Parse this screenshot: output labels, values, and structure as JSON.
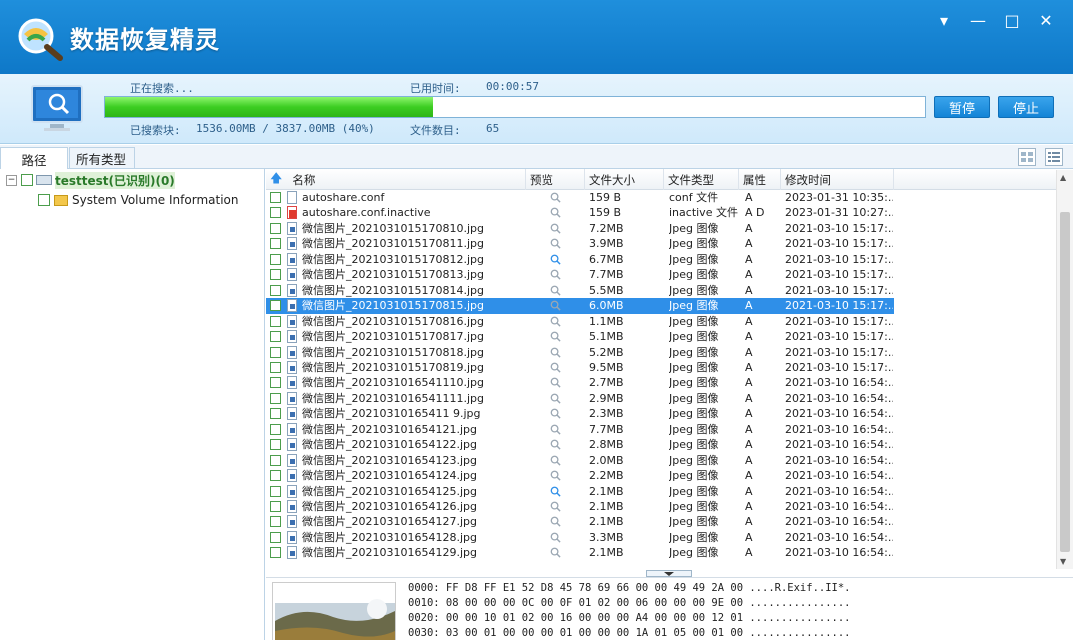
{
  "app": {
    "title": "数据恢复精灵"
  },
  "window_buttons": {
    "menu": "▾",
    "minimize": "—",
    "maximize": "□",
    "close": "✕"
  },
  "status": {
    "searching_label": "正在搜索...",
    "elapsed_label": "已用时间:",
    "elapsed_value": "00:00:57",
    "scanned_label": "已搜索块:",
    "scanned_value": "1536.00MB / 3837.00MB (40%)",
    "file_count_label": "文件数目:",
    "file_count_value": "65",
    "progress": 0.4,
    "pause_button": "暂停",
    "stop_button": "停止"
  },
  "tabs": [
    {
      "label": "路径"
    },
    {
      "label": "所有类型"
    }
  ],
  "tree": [
    {
      "label": "testtest(已识别)(0)"
    },
    {
      "label": "System Volume Information"
    }
  ],
  "columns": [
    "名称",
    "预览",
    "文件大小",
    "文件类型",
    "属性",
    "修改时间"
  ],
  "files": [
    {
      "name": "autoshare.conf",
      "size": "159 B",
      "type": "conf 文件",
      "attr": "A",
      "time": "2023-01-31 10:35:..."
    },
    {
      "name": "autoshare.conf.inactive",
      "size": "159 B",
      "type": "inactive 文件",
      "attr": "A D",
      "time": "2023-01-31 10:27:..."
    },
    {
      "name": "微信图片_2021031015170810.jpg",
      "size": "7.2MB",
      "type": "Jpeg 图像",
      "attr": "A",
      "time": "2021-03-10 15:17:..."
    },
    {
      "name": "微信图片_2021031015170811.jpg",
      "size": "3.9MB",
      "type": "Jpeg 图像",
      "attr": "A",
      "time": "2021-03-10 15:17:..."
    },
    {
      "name": "微信图片_2021031015170812.jpg",
      "size": "6.7MB",
      "type": "Jpeg 图像",
      "attr": "A",
      "time": "2021-03-10 15:17:..."
    },
    {
      "name": "微信图片_2021031015170813.jpg",
      "size": "7.7MB",
      "type": "Jpeg 图像",
      "attr": "A",
      "time": "2021-03-10 15:17:..."
    },
    {
      "name": "微信图片_2021031015170814.jpg",
      "size": "5.5MB",
      "type": "Jpeg 图像",
      "attr": "A",
      "time": "2021-03-10 15:17:..."
    },
    {
      "name": "微信图片_2021031015170815.jpg",
      "size": "6.0MB",
      "type": "Jpeg 图像",
      "attr": "A",
      "time": "2021-03-10 15:17:..."
    },
    {
      "name": "微信图片_2021031015170816.jpg",
      "size": "1.1MB",
      "type": "Jpeg 图像",
      "attr": "A",
      "time": "2021-03-10 15:17:..."
    },
    {
      "name": "微信图片_2021031015170817.jpg",
      "size": "5.1MB",
      "type": "Jpeg 图像",
      "attr": "A",
      "time": "2021-03-10 15:17:..."
    },
    {
      "name": "微信图片_2021031015170818.jpg",
      "size": "5.2MB",
      "type": "Jpeg 图像",
      "attr": "A",
      "time": "2021-03-10 15:17:..."
    },
    {
      "name": "微信图片_2021031015170819.jpg",
      "size": "9.5MB",
      "type": "Jpeg 图像",
      "attr": "A",
      "time": "2021-03-10 15:17:..."
    },
    {
      "name": "微信图片_2021031016541110.jpg",
      "size": "2.7MB",
      "type": "Jpeg 图像",
      "attr": "A",
      "time": "2021-03-10 16:54:..."
    },
    {
      "name": "微信图片_2021031016541111.jpg",
      "size": "2.9MB",
      "type": "Jpeg 图像",
      "attr": "A",
      "time": "2021-03-10 16:54:..."
    },
    {
      "name": "微信图片_20210310165411 9.jpg",
      "size": "2.3MB",
      "type": "Jpeg 图像",
      "attr": "A",
      "time": "2021-03-10 16:54:..."
    },
    {
      "name": "微信图片_202103101654121.jpg",
      "size": "7.7MB",
      "type": "Jpeg 图像",
      "attr": "A",
      "time": "2021-03-10 16:54:..."
    },
    {
      "name": "微信图片_202103101654122.jpg",
      "size": "2.8MB",
      "type": "Jpeg 图像",
      "attr": "A",
      "time": "2021-03-10 16:54:..."
    },
    {
      "name": "微信图片_202103101654123.jpg",
      "size": "2.0MB",
      "type": "Jpeg 图像",
      "attr": "A",
      "time": "2021-03-10 16:54:..."
    },
    {
      "name": "微信图片_202103101654124.jpg",
      "size": "2.2MB",
      "type": "Jpeg 图像",
      "attr": "A",
      "time": "2021-03-10 16:54:..."
    },
    {
      "name": "微信图片_202103101654125.jpg",
      "size": "2.1MB",
      "type": "Jpeg 图像",
      "attr": "A",
      "time": "2021-03-10 16:54:..."
    },
    {
      "name": "微信图片_202103101654126.jpg",
      "size": "2.1MB",
      "type": "Jpeg 图像",
      "attr": "A",
      "time": "2021-03-10 16:54:..."
    },
    {
      "name": "微信图片_202103101654127.jpg",
      "size": "2.1MB",
      "type": "Jpeg 图像",
      "attr": "A",
      "time": "2021-03-10 16:54:..."
    },
    {
      "name": "微信图片_202103101654128.jpg",
      "size": "3.3MB",
      "type": "Jpeg 图像",
      "attr": "A",
      "time": "2021-03-10 16:54:..."
    },
    {
      "name": "微信图片_202103101654129.jpg",
      "size": "2.1MB",
      "type": "Jpeg 图像",
      "attr": "A",
      "time": "2021-03-10 16:54:..."
    }
  ],
  "selected_index": 7,
  "hex_lines": [
    "0000: FF D8 FF E1 52 D8 45 78 69 66 00 00 49 49 2A 00  ....R.Exif..II*.",
    "0010: 08 00 00 00 0C 00 0F 01 02 00 06 00 00 00 9E 00  ................",
    "0020: 00 00 10 01 02 00 16 00 00 00 A4 00 00 00 12 01  ................",
    "0030: 03 00 01 00 00 00 01 00 00 00 1A 01 05 00 01 00  ................"
  ],
  "colors": {
    "title_bar": "#1384d6",
    "progress": "#3ccd22",
    "selection": "#2f8fe8"
  }
}
